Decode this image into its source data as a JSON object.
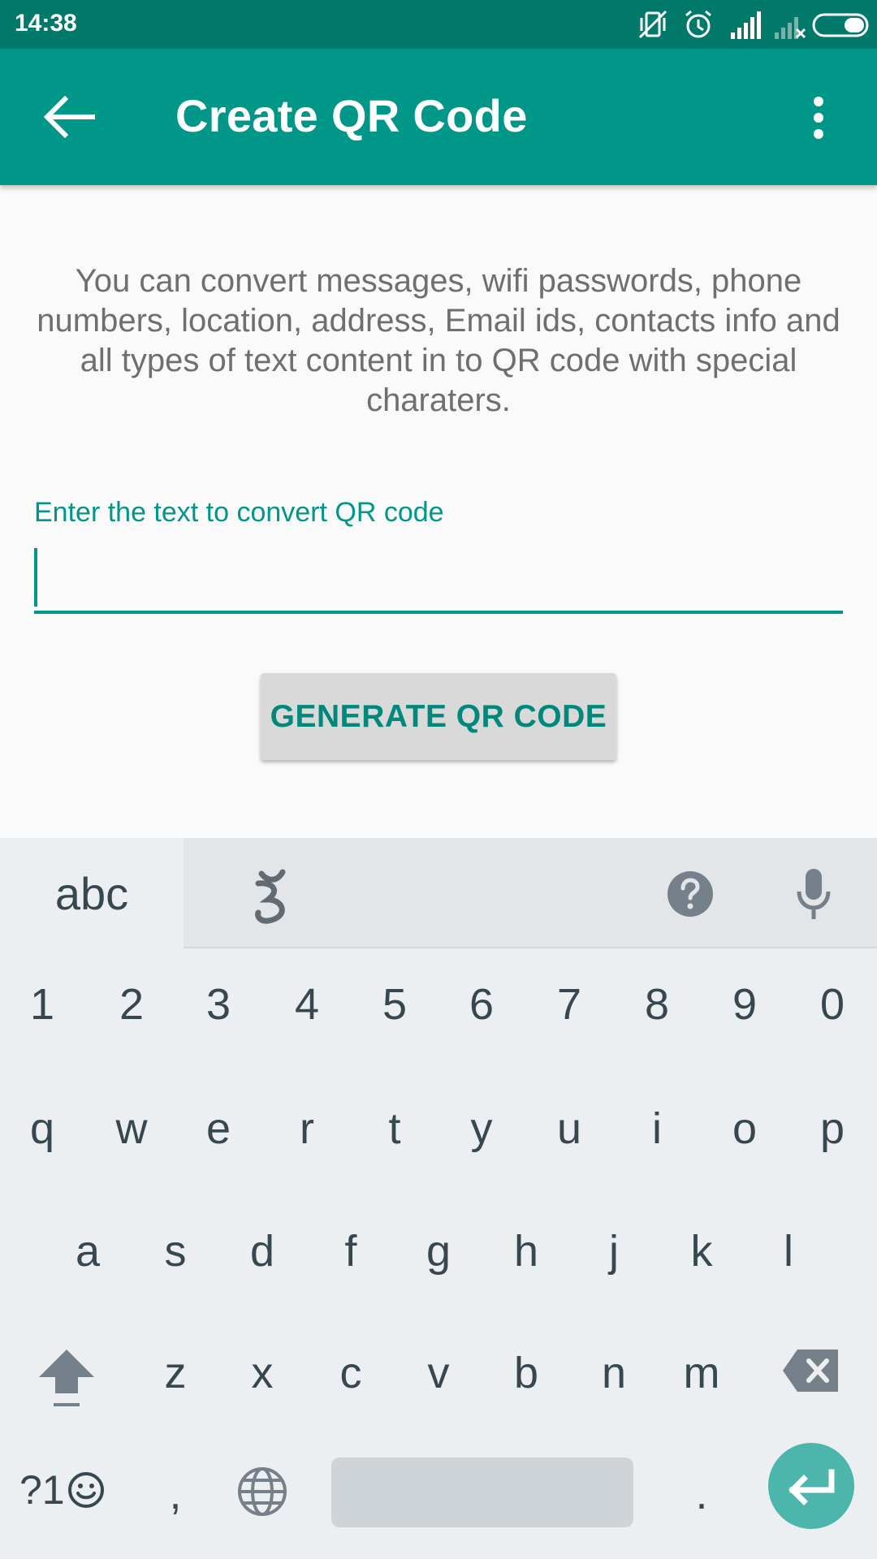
{
  "status_bar": {
    "time": "14:38"
  },
  "app_bar": {
    "title": "Create QR Code"
  },
  "content": {
    "description": "You can convert messages, wifi passwords, phone numbers, location, address, Email ids, contacts info and all types of text content in to QR code with special charaters.",
    "input_label": "Enter the text to convert QR code",
    "input_value": "",
    "generate_button": "GENERATE QR CODE"
  },
  "keyboard": {
    "tab_abc": "abc",
    "number_row": [
      "1",
      "2",
      "3",
      "4",
      "5",
      "6",
      "7",
      "8",
      "9",
      "0"
    ],
    "row_q": [
      "q",
      "w",
      "e",
      "r",
      "t",
      "y",
      "u",
      "i",
      "o",
      "p"
    ],
    "row_a": [
      "a",
      "s",
      "d",
      "f",
      "g",
      "h",
      "j",
      "k",
      "l"
    ],
    "row_z": [
      "z",
      "x",
      "c",
      "v",
      "b",
      "n",
      "m"
    ],
    "symbols_key": "?1",
    "comma": ",",
    "period": "."
  },
  "colors": {
    "status_bar": "#00796b",
    "app_bar": "#009688",
    "accent": "#009688",
    "enter_key": "#4db6ac"
  }
}
